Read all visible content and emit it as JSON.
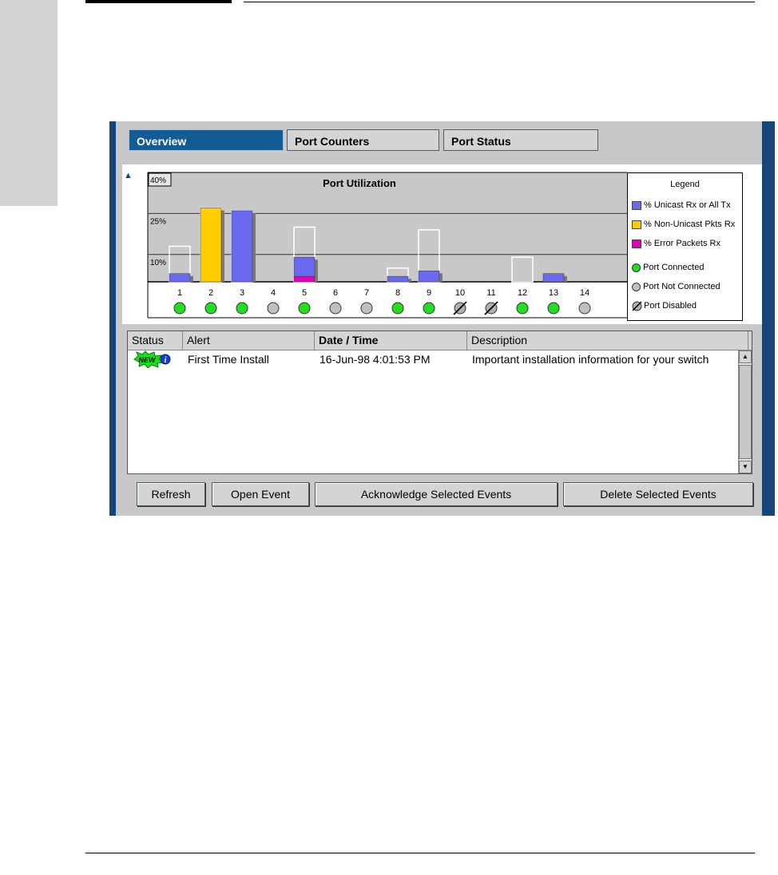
{
  "tabs": [
    {
      "label": "Overview",
      "active": true
    },
    {
      "label": "Port Counters",
      "active": false
    },
    {
      "label": "Port Status",
      "active": false
    }
  ],
  "chart_data": {
    "type": "bar",
    "title": "Port Utilization",
    "categories": [
      "1",
      "2",
      "3",
      "4",
      "5",
      "6",
      "7",
      "8",
      "9",
      "10",
      "11",
      "12",
      "13",
      "14"
    ],
    "y_ticks": [
      "40%",
      "25%",
      "10%"
    ],
    "ylim": [
      0,
      40
    ],
    "series": [
      {
        "name": "% Unicast Rx or All Tx",
        "color": "#6a6af0",
        "values": [
          3,
          0,
          26,
          0,
          7,
          0,
          0,
          2,
          4,
          0,
          0,
          0,
          3,
          0
        ]
      },
      {
        "name": "% Non-Unicast Pkts Rx",
        "color": "#ffcc00",
        "values": [
          0,
          27,
          0,
          0,
          0,
          0,
          0,
          0,
          0,
          0,
          0,
          0,
          0,
          0
        ]
      },
      {
        "name": "% Error Packets Rx",
        "color": "#e000c0",
        "values": [
          0,
          0,
          0,
          0,
          2,
          0,
          0,
          0,
          0,
          0,
          0,
          0,
          0,
          0
        ]
      }
    ],
    "peak_values": [
      13,
      27,
      26,
      0,
      20,
      0,
      0,
      5,
      19,
      0,
      0,
      9,
      0,
      0
    ],
    "port_status": [
      "connected",
      "connected",
      "connected",
      "not_connected",
      "connected",
      "not_connected",
      "not_connected",
      "connected",
      "connected",
      "disabled",
      "disabled",
      "connected",
      "connected",
      "not_connected"
    ],
    "status_colors": {
      "connected": "#22dd22",
      "not_connected": "#c0c0c0",
      "disabled": "#b0b0b0"
    },
    "grid": true
  },
  "legend": {
    "title": "Legend",
    "port_connected": "Port Connected",
    "port_not_connected": "Port Not Connected",
    "port_disabled": "Port Disabled"
  },
  "table": {
    "headers": [
      "Status",
      "Alert",
      "Date / Time",
      "Description"
    ],
    "rows": [
      {
        "status_badge": "NEW",
        "status_icon": "info-icon",
        "alert": "First Time Install",
        "datetime": "16-Jun-98 4:01:53 PM",
        "description": "Important installation information for your switch"
      }
    ]
  },
  "buttons": {
    "refresh": "Refresh",
    "open_event": "Open Event",
    "acknowledge": "Acknowledge Selected Events",
    "delete": "Delete Selected Events"
  }
}
